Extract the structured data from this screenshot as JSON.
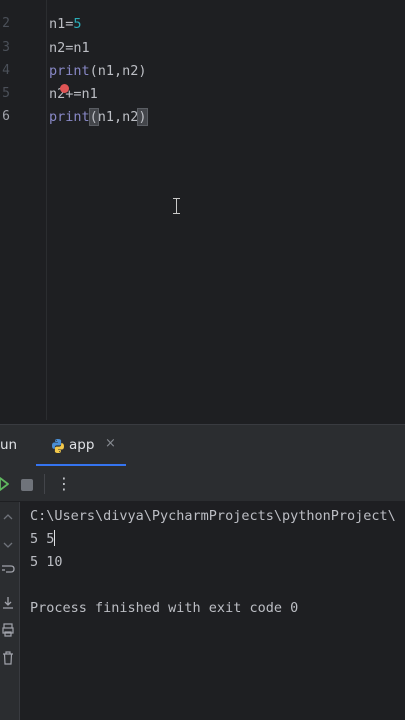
{
  "editor": {
    "line_numbers": [
      "2",
      "3",
      "4",
      "5",
      "6"
    ],
    "current_line": "6",
    "lines": [
      {
        "parts": [
          {
            "t": "n1=",
            "k": "plain"
          },
          {
            "t": "5",
            "k": "num"
          }
        ]
      },
      {
        "parts": [
          {
            "t": "n2=n1",
            "k": "plain"
          }
        ]
      },
      {
        "parts": [
          {
            "t": "print",
            "k": "fn"
          },
          {
            "t": "(n1,n2)",
            "k": "plain"
          }
        ]
      },
      {
        "parts": [
          {
            "t": "n2+=n1",
            "k": "plain"
          }
        ]
      },
      {
        "parts": [
          {
            "t": "print",
            "k": "fn"
          },
          {
            "t": "(",
            "k": "paren"
          },
          {
            "t": "n1,n2",
            "k": "plain"
          },
          {
            "t": ")",
            "k": "paren"
          }
        ]
      }
    ]
  },
  "run_panel": {
    "title": "un",
    "tab_label": "app",
    "tab_close": "×",
    "more_label": "⋮",
    "accent_color": "#3574f0"
  },
  "console": {
    "command": "C:\\Users\\divya\\PycharmProjects\\pythonProject\\",
    "outputs": [
      "5 5",
      "5 10"
    ],
    "exit_message": "Process finished with exit code 0"
  },
  "icons": {
    "rerun": "rerun-icon",
    "stop": "stop-icon",
    "more": "more-vertical-icon",
    "python": "python-icon",
    "scroll_end": "scroll-to-end-icon",
    "download": "soft-wrap-icon",
    "print": "print-icon",
    "trash": "trash-icon"
  }
}
